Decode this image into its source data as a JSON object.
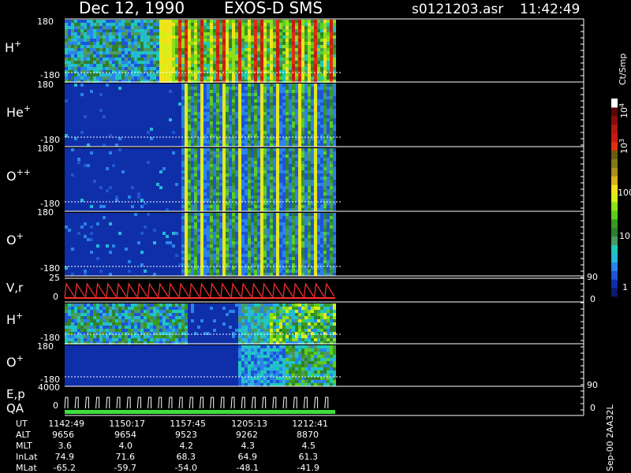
{
  "header": {
    "date": "Dec 12, 1990",
    "mission": "EXOS-D SMS",
    "file": "s0121203.asr",
    "time": "11:42:49"
  },
  "colorbar": {
    "unit_label": "Ct/Smp",
    "tick_labels": [
      "1",
      "10",
      "100",
      "10^3",
      "10^4"
    ],
    "colors": [
      "#0a1a6e",
      "#0f2fa8",
      "#1d55d6",
      "#2a84e8",
      "#27b7d8",
      "#1fc8b8",
      "#4a9a62",
      "#2f7f30",
      "#3a9a1e",
      "#5ccf1c",
      "#8fe01a",
      "#d8ee18",
      "#f3e21a",
      "#d8b21a",
      "#a9901a",
      "#80781c",
      "#6b5a10",
      "#e03010",
      "#c81a10",
      "#b01810",
      "#8a0c0c",
      "#5a0808",
      "#ffffff"
    ]
  },
  "footer": {
    "rows": [
      {
        "label": "UT",
        "values": [
          "1142:49",
          "1150:17",
          "1157:45",
          "1205:13",
          "1212:41"
        ]
      },
      {
        "label": "ALT",
        "values": [
          "9656",
          "9654",
          "9523",
          "9262",
          "8870"
        ]
      },
      {
        "label": "MLT",
        "values": [
          "3.6",
          "4.0",
          "4.2",
          "4.3",
          "4.5"
        ]
      },
      {
        "label": "InLat",
        "values": [
          "74.9",
          "71.6",
          "68.3",
          "64.9",
          "61.3"
        ]
      },
      {
        "label": "MLat",
        "values": [
          "-65.2",
          "-59.7",
          "-54.0",
          "-48.1",
          "-41.9"
        ]
      }
    ]
  },
  "side_label": "Sep-00 2AA32L",
  "chart_data": [
    {
      "type": "heatmap",
      "panel": "H+ (energy-angle)",
      "species": "H",
      "charge": "+",
      "y_top_label": "180",
      "y_bottom_label": "-180",
      "ylim": [
        -180,
        180
      ],
      "bands": 20,
      "data_until_ut": "1216:00"
    },
    {
      "type": "heatmap",
      "panel": "He+ (energy-angle)",
      "species": "He",
      "charge": "+",
      "y_top_label": "180",
      "y_bottom_label": "-180",
      "ylim": [
        -180,
        180
      ],
      "bands": 18
    },
    {
      "type": "heatmap",
      "panel": "O++ (energy-angle)",
      "species": "O",
      "charge": "++",
      "y_top_label": "180",
      "y_bottom_label": "-180",
      "ylim": [
        -180,
        180
      ],
      "bands": 18
    },
    {
      "type": "heatmap",
      "panel": "O+ (energy-angle)",
      "species": "O",
      "charge": "+",
      "y_top_label": "180",
      "y_bottom_label": "-180",
      "ylim": [
        -180,
        180
      ],
      "bands": 18
    },
    {
      "type": "line",
      "panel": "V,r",
      "label": "V,r",
      "y_left_ticks": [
        "25",
        "0"
      ],
      "y_right_ticks": [
        "90",
        "0"
      ],
      "sweep_cycles": 26,
      "color": "#ff3030"
    },
    {
      "type": "heatmap",
      "panel": "H+ (angle)",
      "species": "H",
      "charge": "+",
      "y_top_label": "180",
      "y_bottom_label": "-180",
      "ylim": [
        -180,
        180
      ]
    },
    {
      "type": "heatmap",
      "panel": "O+ (angle)",
      "species": "O",
      "charge": "+",
      "y_top_label": "180",
      "y_bottom_label": "-180",
      "ylim": [
        -180,
        180
      ]
    },
    {
      "type": "line",
      "panel": "E,p QA",
      "label_top": "E,p",
      "label_bottom": "QA",
      "y_left_ticks": [
        "4000",
        "0"
      ],
      "y_right_ticks": [
        "90",
        "0"
      ],
      "sweep_cycles": 26,
      "color": "#ffffff",
      "qa_color": "#3de03d"
    }
  ]
}
